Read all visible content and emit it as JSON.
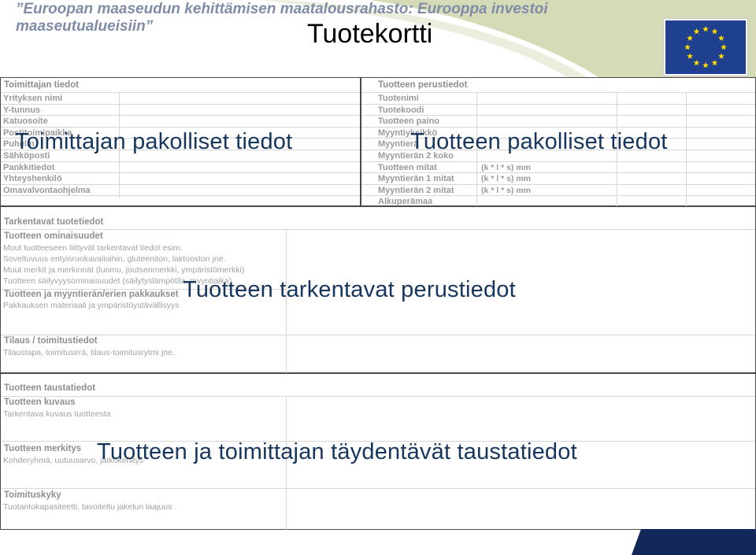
{
  "header": {
    "funding_line": "”Euroopan maaseudun kehittämisen maatalousrahasto: Eurooppa investoi maaseutualueisiin”",
    "title": "Tuotekortti"
  },
  "colors": {
    "accent_green": "#d6dbb7",
    "eu_blue": "#1f3f8f",
    "eu_star": "#ffdd00",
    "overlay_text": "#17365d",
    "corner_navy": "#12275a"
  },
  "supplier": {
    "heading": "Toimittajan tiedot",
    "fields": [
      "Yrityksen nimi",
      "Y-tunnus",
      "Katuosoite",
      "Postitoimipaikka",
      "Puhelin",
      "Sähköposti",
      "Pankkitiedot",
      "Yhteyshenkilö",
      "Omavalvontaohjelma"
    ],
    "overlay": "Toimittajan pakolliset tiedot"
  },
  "product_basic": {
    "heading": "Tuotteen perustiedot",
    "fields": [
      "Tuotenimi",
      "Tuotekoodi",
      "Tuotteen paino",
      "Myyntiyksikkö",
      "Myyntierä",
      "Myyntierän 2 koko",
      "Tuotteen mitat",
      "Myyntierän 1 mitat",
      "Myyntierän 2 mitat",
      "Alkuperämaa"
    ],
    "units": [
      "",
      "",
      "",
      "",
      "",
      "",
      "(k * l * s) mm",
      "(k * l * s) mm",
      "(k * l * s) mm",
      ""
    ],
    "overlay": "Tuotteen pakolliset tiedot"
  },
  "product_detail": {
    "heading": "Tarkentavat tuotetiedot",
    "group1_title": "Tuotteen ominaisuudet",
    "group1_lines": [
      "Muut tuotteeseen liittyvät tarkentavat tiedot esim.",
      "Soveltuvuus erityisruokavalioihin, gluteeniton, laktooston jne.",
      "Muut merkit ja merkinnät (luomu, joutsenmerkki, ympäristömerkki)",
      "Tuotteen säilyvyysominaisuudet (säilytyslämpötila, myyntiaika)"
    ],
    "group2_title": "Tuotteen ja myyntierän/erien pakkaukset",
    "group2_lines": [
      "Pakkauksen materiaali ja  ympäristöystävällisyys"
    ],
    "group3_title": "Tilaus / toimitustiedot",
    "group3_lines": [
      "Tilaustapa, toimituserä, tilaus-toimitusrytmi jne."
    ],
    "overlay": "Tuotteen tarkentavat perustiedot"
  },
  "background": {
    "heading": "Tuotteen taustatiedot",
    "group1_title": "Tuotteen kuvaus",
    "group1_lines": [
      "Tarkentava kuvaus tuotteesta"
    ],
    "group2_title": "Tuotteen merkitys",
    "group2_lines": [
      "Kohderyhmä, uutuusarvo, jatkokehitys"
    ],
    "group3_title": "Toimituskyky",
    "group3_lines": [
      "Tuotantokapasiteetti, tavoiteltu jakelun laajuus"
    ],
    "overlay": "Tuotteen ja toimittajan täydentävät taustatiedot"
  }
}
